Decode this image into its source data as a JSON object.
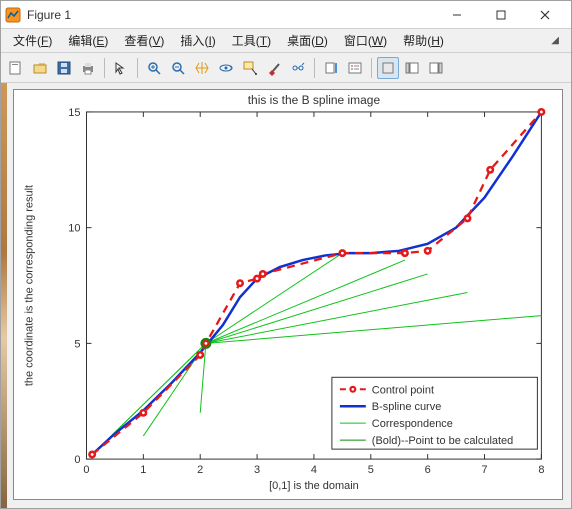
{
  "window": {
    "title": "Figure 1"
  },
  "menu": {
    "items": [
      {
        "label": "文件",
        "accel": "F"
      },
      {
        "label": "编辑",
        "accel": "E"
      },
      {
        "label": "查看",
        "accel": "V"
      },
      {
        "label": "插入",
        "accel": "I"
      },
      {
        "label": "工具",
        "accel": "T"
      },
      {
        "label": "桌面",
        "accel": "D"
      },
      {
        "label": "窗口",
        "accel": "W"
      },
      {
        "label": "帮助",
        "accel": "H"
      }
    ]
  },
  "chart_data": {
    "type": "line",
    "title": "this is the B spline image",
    "xlabel": "[0,1] is the domain",
    "ylabel": "the coordinate is the corresponding result",
    "xlim": [
      0,
      8
    ],
    "ylim": [
      0,
      15
    ],
    "xticks": [
      0,
      1,
      2,
      3,
      4,
      5,
      6,
      7,
      8
    ],
    "yticks": [
      0,
      5,
      10,
      15
    ],
    "series": [
      {
        "name": "Control point",
        "style": "red-dashed-marker",
        "x": [
          0.1,
          1.0,
          2.0,
          2.1,
          2.7,
          3.0,
          3.1,
          4.5,
          5.6,
          6.0,
          6.7,
          7.1,
          8.0
        ],
        "y": [
          0.2,
          2.0,
          4.5,
          5.0,
          7.6,
          7.8,
          8.0,
          8.9,
          8.9,
          9.0,
          10.4,
          12.5,
          15.0
        ]
      },
      {
        "name": "B-spline curve",
        "style": "blue-solid",
        "x": [
          0.1,
          0.5,
          1.0,
          1.5,
          2.0,
          2.4,
          2.7,
          3.0,
          3.4,
          3.8,
          4.2,
          4.6,
          5.0,
          5.5,
          6.0,
          6.5,
          7.0,
          7.5,
          8.0
        ],
        "y": [
          0.2,
          1.1,
          2.1,
          3.3,
          4.6,
          5.8,
          7.0,
          7.8,
          8.3,
          8.6,
          8.8,
          8.9,
          8.9,
          9.0,
          9.3,
          10.0,
          11.3,
          13.1,
          15.0
        ]
      },
      {
        "name": "Correspondence",
        "style": "green-lines",
        "origin": {
          "x": 2.1,
          "y": 5.0
        },
        "targets": [
          {
            "x": 0.1,
            "y": 0.2
          },
          {
            "x": 1.0,
            "y": 1.0
          },
          {
            "x": 2.0,
            "y": 2.0
          },
          {
            "x": 4.5,
            "y": 8.9
          },
          {
            "x": 5.6,
            "y": 8.6
          },
          {
            "x": 6.0,
            "y": 8.0
          },
          {
            "x": 6.7,
            "y": 7.2
          },
          {
            "x": 8.0,
            "y": 6.2
          }
        ]
      },
      {
        "name": "(Bold)--Point to be calculated",
        "style": "bold-point",
        "point": {
          "x": 2.1,
          "y": 5.0
        }
      }
    ],
    "legend": {
      "position": "lower-right",
      "entries": [
        "Control point",
        "B-spline curve",
        "Correspondence",
        "(Bold)--Point to be calculated"
      ]
    }
  }
}
